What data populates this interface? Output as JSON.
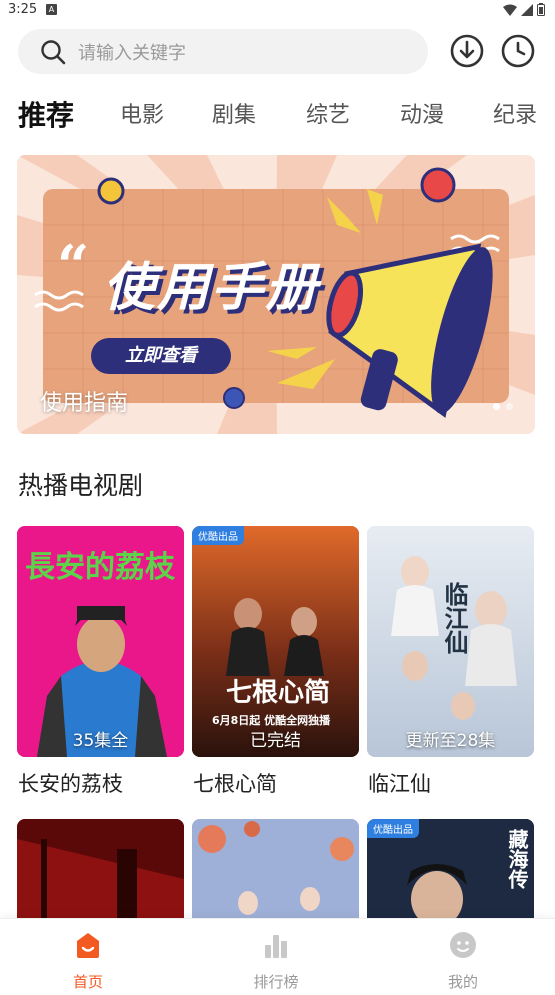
{
  "status_bar": {
    "time": "3:25",
    "notification_glyph": "A"
  },
  "search": {
    "placeholder": "请输入关键字"
  },
  "header_icons": [
    "download-icon",
    "history-icon"
  ],
  "tabs": [
    {
      "label": "推荐",
      "active": true
    },
    {
      "label": "电影",
      "active": false
    },
    {
      "label": "剧集",
      "active": false
    },
    {
      "label": "综艺",
      "active": false
    },
    {
      "label": "动漫",
      "active": false
    },
    {
      "label": "纪录",
      "active": false
    }
  ],
  "banner": {
    "title": "使用手册",
    "button": "立即查看",
    "caption": "使用指南",
    "pages": 2,
    "current_page": 1
  },
  "section": {
    "title": "热播电视剧",
    "shows": [
      {
        "title": "长安的荔枝",
        "status": "35集全",
        "badge": "",
        "art_text": "長安的荔枝"
      },
      {
        "title": "七根心简",
        "status": "已完结",
        "badge": "优酷出品",
        "art_text": "七根心简",
        "art_subtext": "6月8日起 优酷全网独播"
      },
      {
        "title": "临江仙",
        "status": "更新至28集",
        "badge": "",
        "art_text": "临江仙"
      }
    ],
    "more_shows": [
      {
        "badge": ""
      },
      {
        "badge": ""
      },
      {
        "badge": "优酷出品",
        "art_text": "藏海传"
      }
    ]
  },
  "bottom_nav": [
    {
      "label": "首页",
      "icon": "home-icon",
      "active": true
    },
    {
      "label": "排行榜",
      "icon": "ranking-icon",
      "active": false
    },
    {
      "label": "我的",
      "icon": "profile-icon",
      "active": false
    }
  ],
  "colors": {
    "accent": "#f25a22",
    "banner_navy": "#2d2f7a",
    "badge_blue": "#2f7fe0"
  }
}
